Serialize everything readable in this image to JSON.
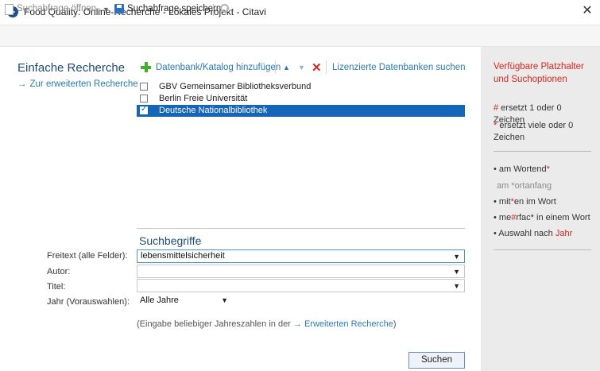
{
  "window": {
    "title": "Food Quality: Online-Recherche - Lokales Projekt - Citavi",
    "close_glyph": "✕"
  },
  "toolbar": {
    "open_label": "Suchabfrage öffnen...",
    "open_arrow": "▼",
    "save_label": "Suchabfrage speichern"
  },
  "nav": {
    "heading": "Einfache Recherche",
    "link_arrow": "→",
    "link_label": "Zur erweiterten Recherche"
  },
  "db_toolbar": {
    "add_label": "Datenbank/Katalog hinzufügen",
    "up_glyph": "▲",
    "down_glyph": "▼",
    "delete_glyph": "✕",
    "licensed_label": "Lizenzierte Datenbanken suchen"
  },
  "databases": [
    {
      "label": "GBV Gemeinsamer Bibliotheksverbund",
      "checked": false
    },
    {
      "label": "Berlin Freie Universität",
      "checked": false
    },
    {
      "label": "Deutsche Nationalbibliothek",
      "checked": true
    }
  ],
  "search": {
    "heading": "Suchbegriffe",
    "freetext_label": "Freitext (alle Felder):",
    "freetext_value": "lebensmittelsicherheit",
    "author_label": "Autor:",
    "author_value": "",
    "title_label": "Titel:",
    "title_value": "",
    "year_label": "Jahr (Vorauswahlen):",
    "year_value": "Alle Jahre",
    "dropdown_glyph": "▼",
    "hint_prefix": "(Eingabe beliebiger Jahreszahlen in der ",
    "hint_arrow": "→",
    "hint_link": "Erweiterten Recherche",
    "hint_suffix": ")",
    "submit_label": "Suchen"
  },
  "help_panel": {
    "heading": "Verfügbare Platzhalter und Suchoptionen",
    "hash_symbol": "#",
    "hash_text": " ersetzt 1 oder 0 Zeichen",
    "star_symbol": "*",
    "star_text": " ersetzt viele oder 0 Zeichen",
    "examples": [
      {
        "bullet": "•",
        "before": " am Wortend",
        "mark": "*",
        "after": ""
      },
      {
        "bullet": "",
        "before": "am ",
        "mark": "*",
        "after": "ortanfang"
      },
      {
        "bullet": "•",
        "before": " mit",
        "mark": "*",
        "after": "en im Wort"
      },
      {
        "bullet": "•",
        "before": " me",
        "mark": "#",
        "after": "rfac* in einem Wort"
      },
      {
        "bullet": "•",
        "before": " Auswahl nach ",
        "mark": "Jahr",
        "after": ""
      }
    ]
  },
  "colors": {
    "accent_blue": "#1e4a78",
    "link_blue": "#2a7ab8",
    "selection_blue": "#1565b8",
    "help_red": "#d9261c",
    "panel_grey": "#ebebeb"
  }
}
